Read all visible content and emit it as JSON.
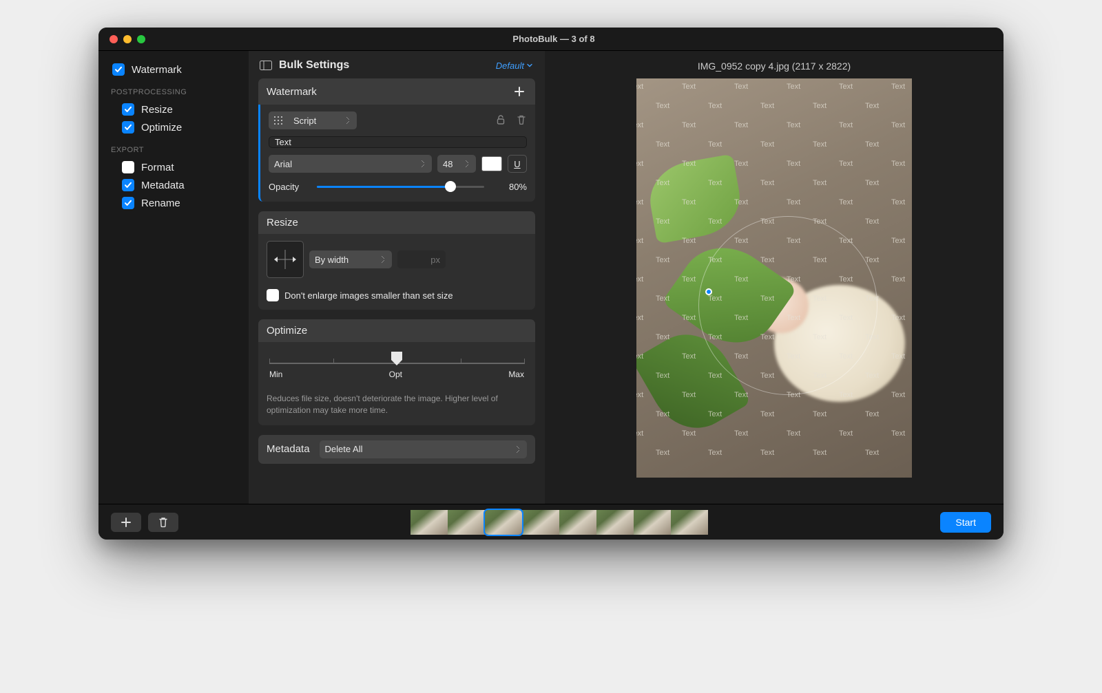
{
  "window": {
    "title": "PhotoBulk — 3 of 8"
  },
  "sidebar": {
    "watermark": {
      "label": "Watermark",
      "checked": true
    },
    "heading_post": "POSTPROCESSING",
    "resize": {
      "label": "Resize",
      "checked": true
    },
    "optimize": {
      "label": "Optimize",
      "checked": true
    },
    "heading_export": "EXPORT",
    "format": {
      "label": "Format",
      "checked": false
    },
    "metadata": {
      "label": "Metadata",
      "checked": true
    },
    "rename": {
      "label": "Rename",
      "checked": true
    }
  },
  "bulk": {
    "title": "Bulk Settings",
    "preset": "Default"
  },
  "watermark": {
    "title": "Watermark",
    "type": "Script",
    "text_value": "Text",
    "font": "Arial",
    "size": "48",
    "underline": "U",
    "opacity_label": "Opacity",
    "opacity_pct": 80,
    "opacity_text": "80%",
    "color": "#ffffff"
  },
  "resize": {
    "title": "Resize",
    "mode": "By width",
    "unit": "px",
    "dont_enlarge": "Don't enlarge images smaller than set size",
    "dont_enlarge_checked": false
  },
  "optimize": {
    "title": "Optimize",
    "min": "Min",
    "opt": "Opt",
    "max": "Max",
    "value_pct": 50,
    "desc": "Reduces file size, doesn't deteriorate the image. Higher level of optimization may take more time."
  },
  "metadata": {
    "title": "Metadata",
    "action": "Delete All"
  },
  "preview": {
    "filename": "IMG_0952 copy 4.jpg (2117 x 2822)",
    "watermark_word": "Text"
  },
  "footer": {
    "start": "Start",
    "thumb_count": 8,
    "selected_index": 2
  }
}
